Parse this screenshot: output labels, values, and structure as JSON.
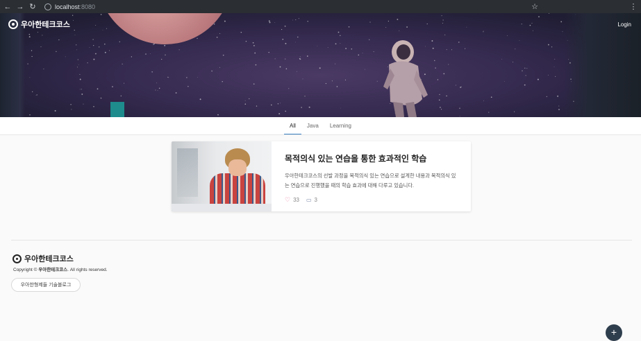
{
  "browser": {
    "url_host": "localhost",
    "url_port": ":8080"
  },
  "header": {
    "brand": "우아한테크코스",
    "login_label": "Login"
  },
  "tabs": [
    {
      "label": "All",
      "active": true
    },
    {
      "label": "Java",
      "active": false
    },
    {
      "label": "Learning",
      "active": false
    }
  ],
  "post": {
    "title": "목적의식 있는 연습을 통한 효과적인 학습",
    "description": "우아한테크코스의 선발 과정을 목적의식 있는 연습으로 설계한 내용과 목적의식 있는 연습으로 진행했을 때의 학습 효과에 대해 다루고 있습니다.",
    "likes": "33",
    "comments": "3"
  },
  "footer": {
    "brand": "우아한테크코스",
    "copyright_prefix": "Copyright © ",
    "copyright_brand": "우아한테크코스",
    "copyright_suffix": ". All rights reserved.",
    "blog_button": "우아한형제들 기술블로그"
  },
  "fab": {
    "label": "+"
  },
  "colors": {
    "tab_active_underline": "#3b82c4",
    "heart": "#e57398",
    "fab": "#2f3e4d"
  }
}
